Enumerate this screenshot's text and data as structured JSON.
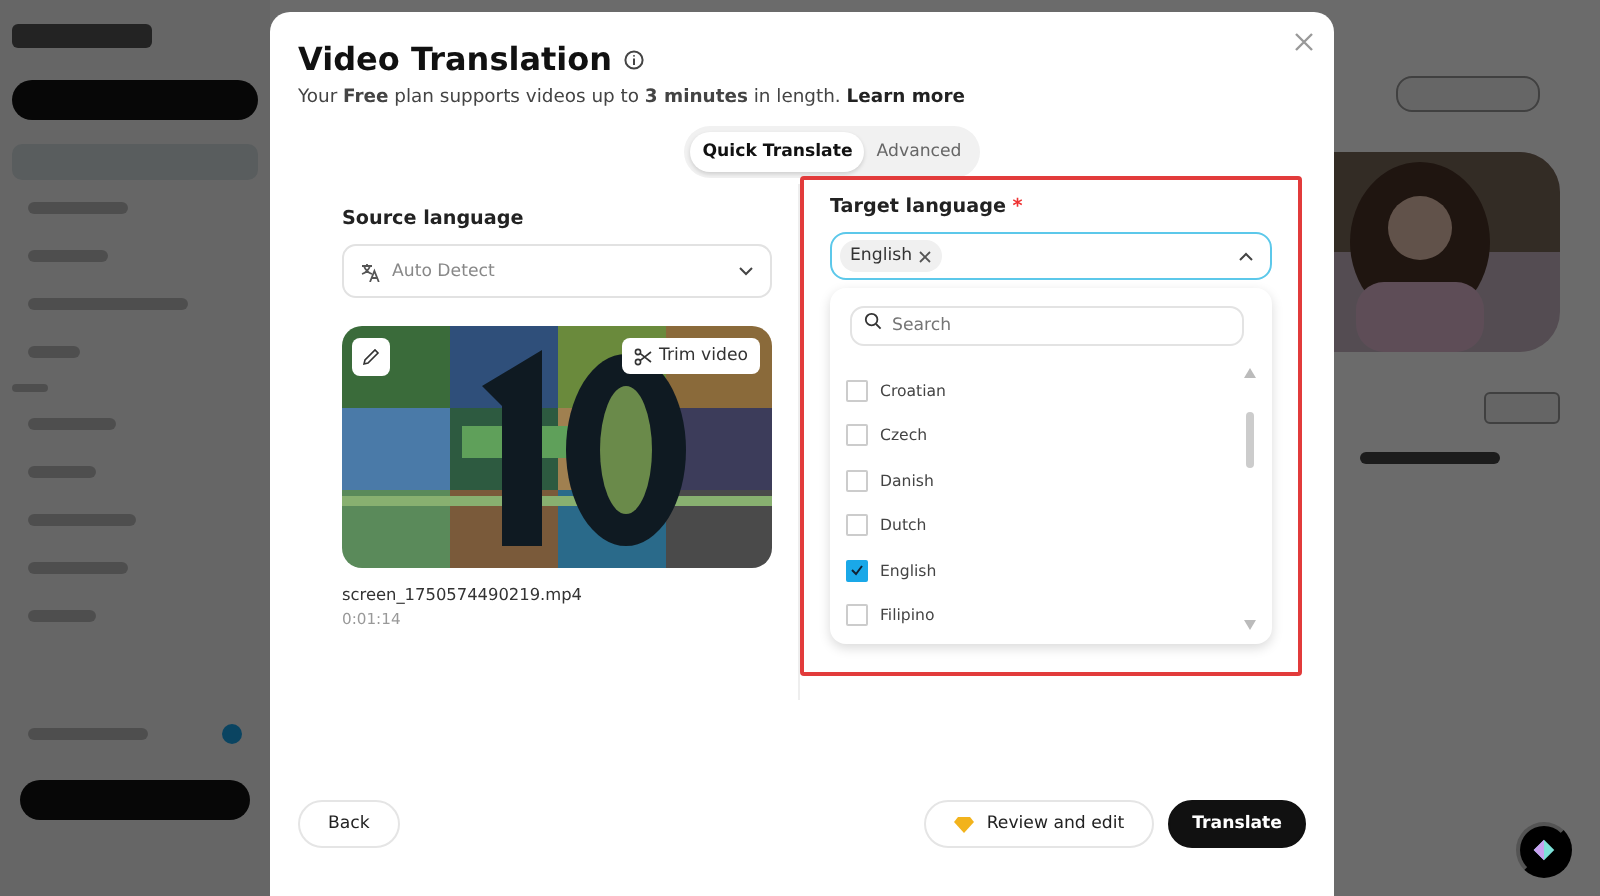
{
  "dialog": {
    "title": "Video Translation",
    "subtitle": "Your **Free** plan supports videos up to **3 minutes** in length.",
    "learn_more": "Learn more",
    "tabs": [
      {
        "label": "Quick Translate",
        "selected": true
      },
      {
        "label": "Advanced",
        "selected": false
      }
    ],
    "source": {
      "label": "Source language",
      "value": "Auto Detect"
    },
    "video": {
      "trim_button": "Trim video",
      "filename": "screen_1750574490219.mp4",
      "duration": "0:01:14"
    },
    "target": {
      "label": "Target language",
      "required": "*",
      "chips": [
        "English"
      ],
      "search_placeholder": "Search",
      "options": [
        {
          "label": "Croatian",
          "checked": false
        },
        {
          "label": "Czech",
          "checked": false
        },
        {
          "label": "Danish",
          "checked": false
        },
        {
          "label": "Dutch",
          "checked": false
        },
        {
          "label": "English",
          "checked": true
        },
        {
          "label": "Filipino",
          "checked": false
        }
      ]
    },
    "buttons": {
      "back": "Back",
      "review": "Review and edit",
      "translate": "Translate"
    }
  }
}
